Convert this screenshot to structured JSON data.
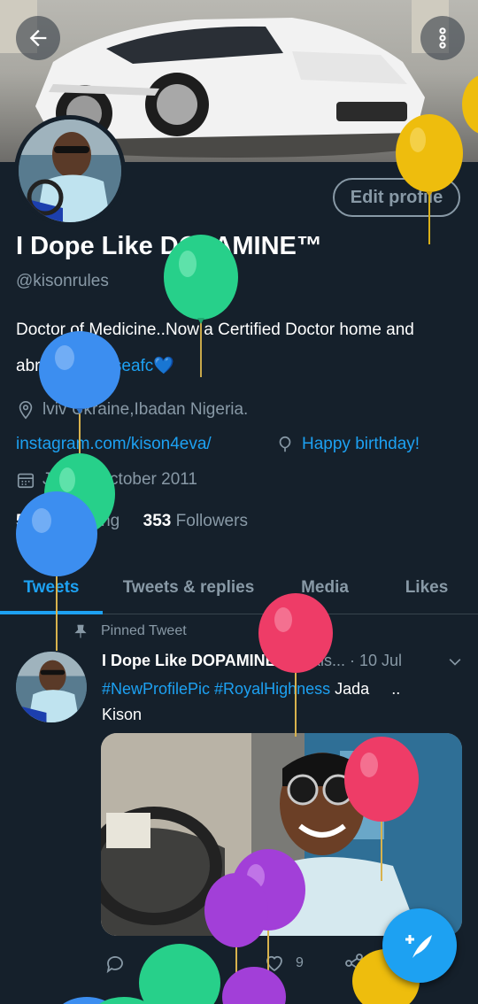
{
  "header": {
    "back_icon": "arrow-left-icon",
    "more_icon": "more-vertical-icon"
  },
  "profile": {
    "edit_button": "Edit profile",
    "name": "I Dope Like DOPAMINE™",
    "handle": "@kisonrules",
    "bio_text": "Doctor of Medicine..Now a Certified Doctor home and abroad.",
    "bio_hashtag": "#chelseafc",
    "bio_emoji": "💙",
    "location": "lviv Ukraine,Ibadan Nigeria.",
    "website": "instagram.com/kison4eva/",
    "birthday": "Happy birthday!",
    "joined": "Joined October 2011",
    "following_count": "526",
    "following_label": "Following",
    "followers_count": "353",
    "followers_label": "Followers"
  },
  "tabs": [
    {
      "label": "Tweets",
      "active": true
    },
    {
      "label": "Tweets & replies",
      "active": false
    },
    {
      "label": "Media",
      "active": false
    },
    {
      "label": "Likes",
      "active": false
    }
  ],
  "tweet": {
    "pinned_label": "Pinned Tweet",
    "author_name": "I Dope Like DOPAMINE™",
    "author_handle_date": "@kis... · 10 Jul",
    "hashtags": "#NewProfilePic #RoyalHighness",
    "text_tail": "Jada",
    "text_line2": "..",
    "text_line3": "Kison",
    "like_count": "9"
  },
  "colors": {
    "background": "#15202b",
    "accent": "#1da1f2",
    "muted": "#8899a6",
    "divider": "#38444d"
  }
}
